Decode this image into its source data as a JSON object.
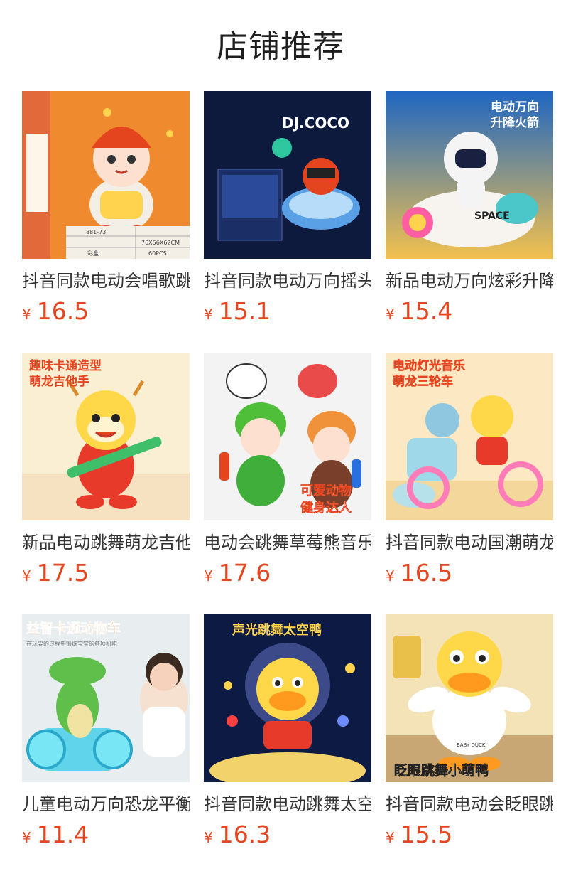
{
  "header": {
    "title": "店铺推荐"
  },
  "colors": {
    "price": "#e4451f",
    "text": "#333333"
  },
  "products": [
    {
      "name": "抖音同款电动会唱歌跳舞萌龙",
      "currency": "¥",
      "price": "16.5",
      "image_icon": "cartoon-dragon-doll-icon",
      "badge": "",
      "image_text": [
        "881-73",
        "彩盒",
        "76X56X62CM",
        "60PCS"
      ]
    },
    {
      "name": "抖音同款电动万向摇头DJ音乐",
      "currency": "¥",
      "price": "15.1",
      "image_icon": "dj-toy-box-icon",
      "badge": "DJ.COCO",
      "image_text": []
    },
    {
      "name": "新品电动万向炫彩升降火箭",
      "currency": "¥",
      "price": "15.4",
      "image_icon": "astronaut-rocket-icon",
      "badge": "电动万向\n升降火箭",
      "image_text": [
        "SPACE"
      ]
    },
    {
      "name": "新品电动跳舞萌龙吉他手玩具",
      "currency": "¥",
      "price": "17.5",
      "image_icon": "dragon-guitar-icon",
      "badge": "趣味卡通造型\n萌龙吉他手",
      "image_text": []
    },
    {
      "name": "电动会跳舞草莓熊音乐健身",
      "currency": "¥",
      "price": "17.6",
      "image_icon": "animal-fitness-dolls-icon",
      "badge": "可爱动物\n健身达人",
      "image_text": []
    },
    {
      "name": "抖音同款电动国潮萌龙三轮车",
      "currency": "¥",
      "price": "16.5",
      "image_icon": "dragon-tricycle-icon",
      "badge": "电动灯光音乐\n萌龙三轮车",
      "image_text": []
    },
    {
      "name": "儿童电动万向恐龙平衡车",
      "currency": "¥",
      "price": "11.4",
      "image_icon": "crocodile-car-icon",
      "badge": "益智卡通动物车",
      "image_text": [
        "在玩耍的过程中锻炼宝宝的各项机能"
      ]
    },
    {
      "name": "抖音同款电动跳舞太空鸭",
      "currency": "¥",
      "price": "16.3",
      "image_icon": "space-duck-icon",
      "badge": "声光跳舞太空鸭",
      "image_text": []
    },
    {
      "name": "抖音同款电动会眨眼跳舞小萌鸭",
      "currency": "¥",
      "price": "15.5",
      "image_icon": "yellow-duck-icon",
      "badge": "眨眼跳舞小萌鸭",
      "image_text": [
        "BABY DUCK"
      ]
    }
  ]
}
